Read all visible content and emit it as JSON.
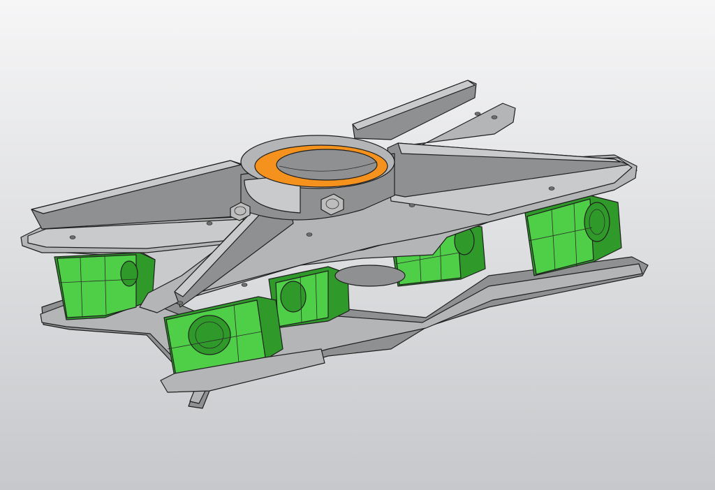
{
  "viewport": {
    "background_top": "#f6f6f7",
    "background_bottom": "#c6c8cb"
  },
  "model": {
    "plate_color": "#b4b5b6",
    "plate_light": "#c9cacb",
    "plate_dark": "#8f9091",
    "block_color": "#4fcf47",
    "block_light": "#6fe063",
    "block_dark": "#2f9a2a",
    "insert_color": "#f5921e",
    "blocks": [
      {
        "label": "left-front-block"
      },
      {
        "label": "center-front-block"
      },
      {
        "label": "center-rear-block"
      },
      {
        "label": "right-mid-block"
      },
      {
        "label": "right-far-block"
      }
    ]
  }
}
